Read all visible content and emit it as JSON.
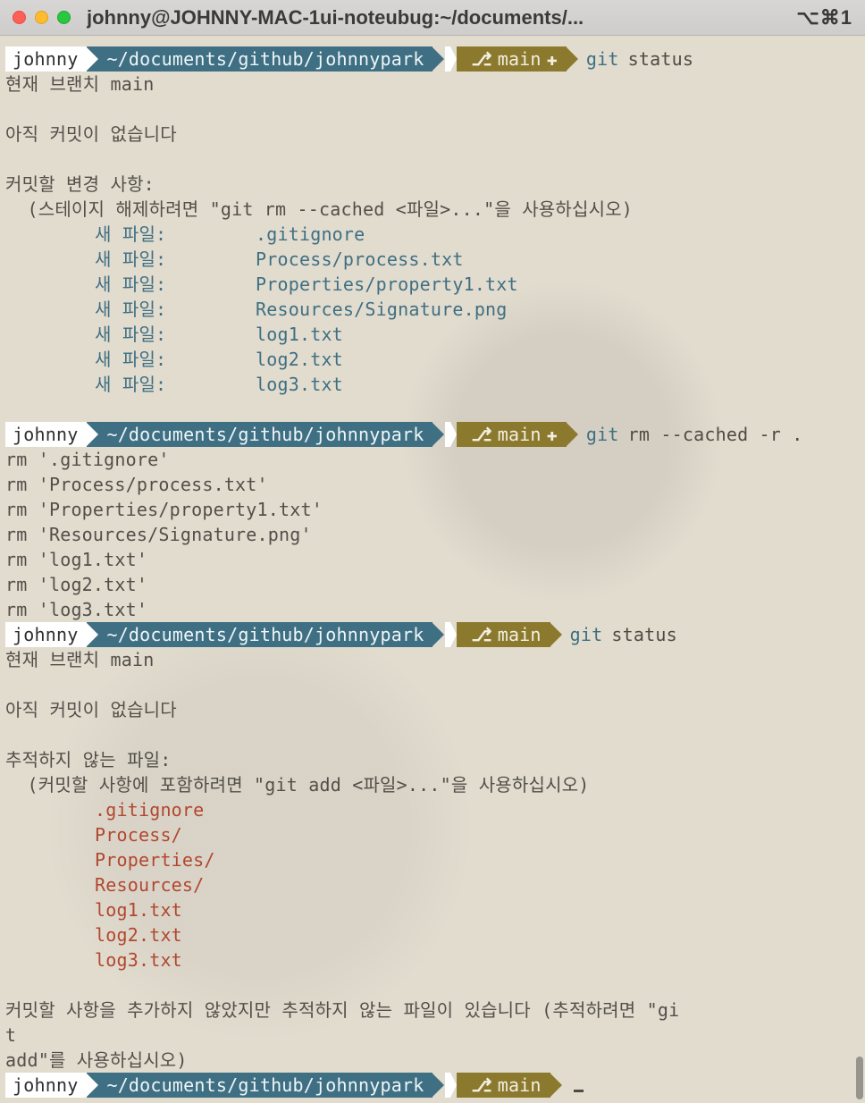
{
  "titlebar": {
    "title": "johnny@JOHNNY-MAC-1ui-noteubug:~/documents/...",
    "shortcut": "⌥⌘1"
  },
  "p": {
    "user": "johnny",
    "path": "~/documents/github/johnnypark",
    "branch": "main",
    "plusmark": "✚",
    "branchicon": "⎇"
  },
  "cmds": {
    "git": "git",
    "status": "status",
    "rmcached": "rm --cached -r .",
    "empty": ""
  },
  "s1": {
    "l1": "현재 브랜치 main",
    "l2": "아직 커밋이 없습니다",
    "l3": "커밋할 변경 사항:",
    "l4": "  (스테이지 해제하려면 \"git rm --cached <파일>...\"을 사용하십시오)",
    "label": "새 파일:",
    "files": [
      ".gitignore",
      "Process/process.txt",
      "Properties/property1.txt",
      "Resources/Signature.png",
      "log1.txt",
      "log2.txt",
      "log3.txt"
    ]
  },
  "rmout": [
    "rm '.gitignore'",
    "rm 'Process/process.txt'",
    "rm 'Properties/property1.txt'",
    "rm 'Resources/Signature.png'",
    "rm 'log1.txt'",
    "rm 'log2.txt'",
    "rm 'log3.txt'"
  ],
  "s2": {
    "l1": "현재 브랜치 main",
    "l2": "아직 커밋이 없습니다",
    "l3": "추적하지 않는 파일:",
    "l4": "  (커밋할 사항에 포함하려면 \"git add <파일>...\"을 사용하십시오)",
    "files": [
      ".gitignore",
      "Process/",
      "Properties/",
      "Resources/",
      "log1.txt",
      "log2.txt",
      "log3.txt"
    ],
    "t1": "커밋할 사항을 추가하지 않았지만 추적하지 않는 파일이 있습니다 (추적하려면 \"gi",
    "t2": "t",
    "t3": "add\"를 사용하십시오)"
  }
}
